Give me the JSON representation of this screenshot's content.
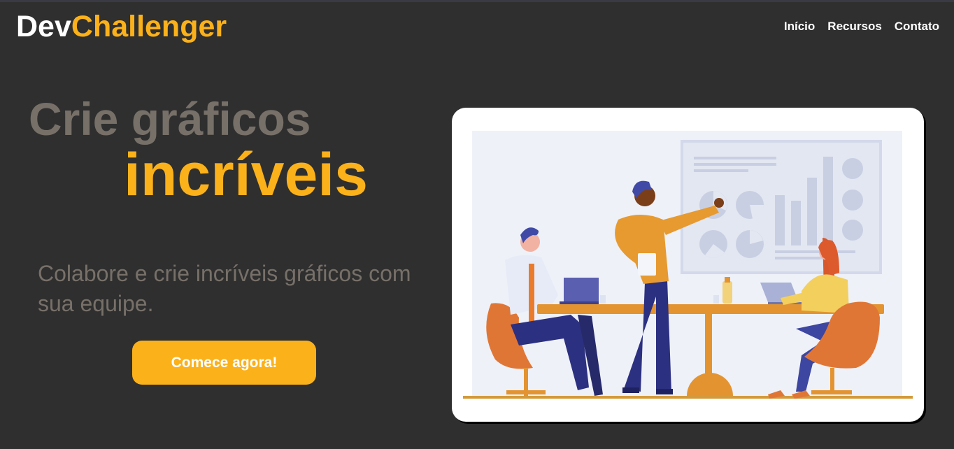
{
  "header": {
    "logo_prefix": "Dev",
    "logo_suffix": "Challenger",
    "nav": [
      "Início",
      "Recursos",
      "Contato"
    ]
  },
  "hero": {
    "title_line1": "Crie gráficos",
    "title_line2": "incríveis",
    "subtitle": "Colabore e crie incríveis gráficos com sua equipe.",
    "cta_label": "Comece agora!"
  },
  "illustration": {
    "icon": "team-meeting-illustration"
  },
  "colors": {
    "background": "#2f2f2f",
    "accent": "#fbb11a",
    "muted_text": "#777069",
    "white": "#ffffff"
  }
}
